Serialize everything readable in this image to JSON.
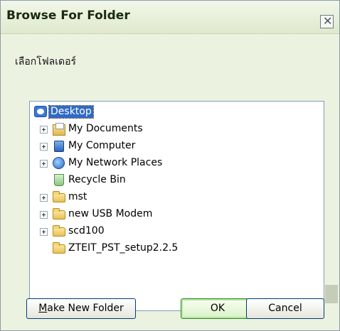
{
  "window": {
    "title": "Browse For Folder",
    "close_glyph": "✕"
  },
  "prompt": "เลือกโฟลเดอร์",
  "tree": {
    "items": [
      {
        "label": "Desktop",
        "icon": "desktop-icon",
        "expandable": false,
        "selected": true
      },
      {
        "label": "My Documents",
        "icon": "my-documents-icon",
        "expandable": true,
        "selected": false
      },
      {
        "label": "My Computer",
        "icon": "my-computer-icon",
        "expandable": true,
        "selected": false
      },
      {
        "label": "My Network Places",
        "icon": "network-places-icon",
        "expandable": true,
        "selected": false
      },
      {
        "label": "Recycle Bin",
        "icon": "recycle-bin-icon",
        "expandable": false,
        "selected": false
      },
      {
        "label": "mst",
        "icon": "folder-icon",
        "expandable": true,
        "selected": false
      },
      {
        "label": "new USB Modem",
        "icon": "folder-icon",
        "expandable": true,
        "selected": false
      },
      {
        "label": "scd100",
        "icon": "folder-icon",
        "expandable": true,
        "selected": false
      },
      {
        "label": "ZTEIT_PST_setup2.2.5",
        "icon": "folder-icon",
        "expandable": false,
        "selected": false
      }
    ]
  },
  "buttons": {
    "make_new_folder_m": "M",
    "make_new_folder_rest": "ake New Folder",
    "ok": "OK",
    "cancel": "Cancel"
  }
}
